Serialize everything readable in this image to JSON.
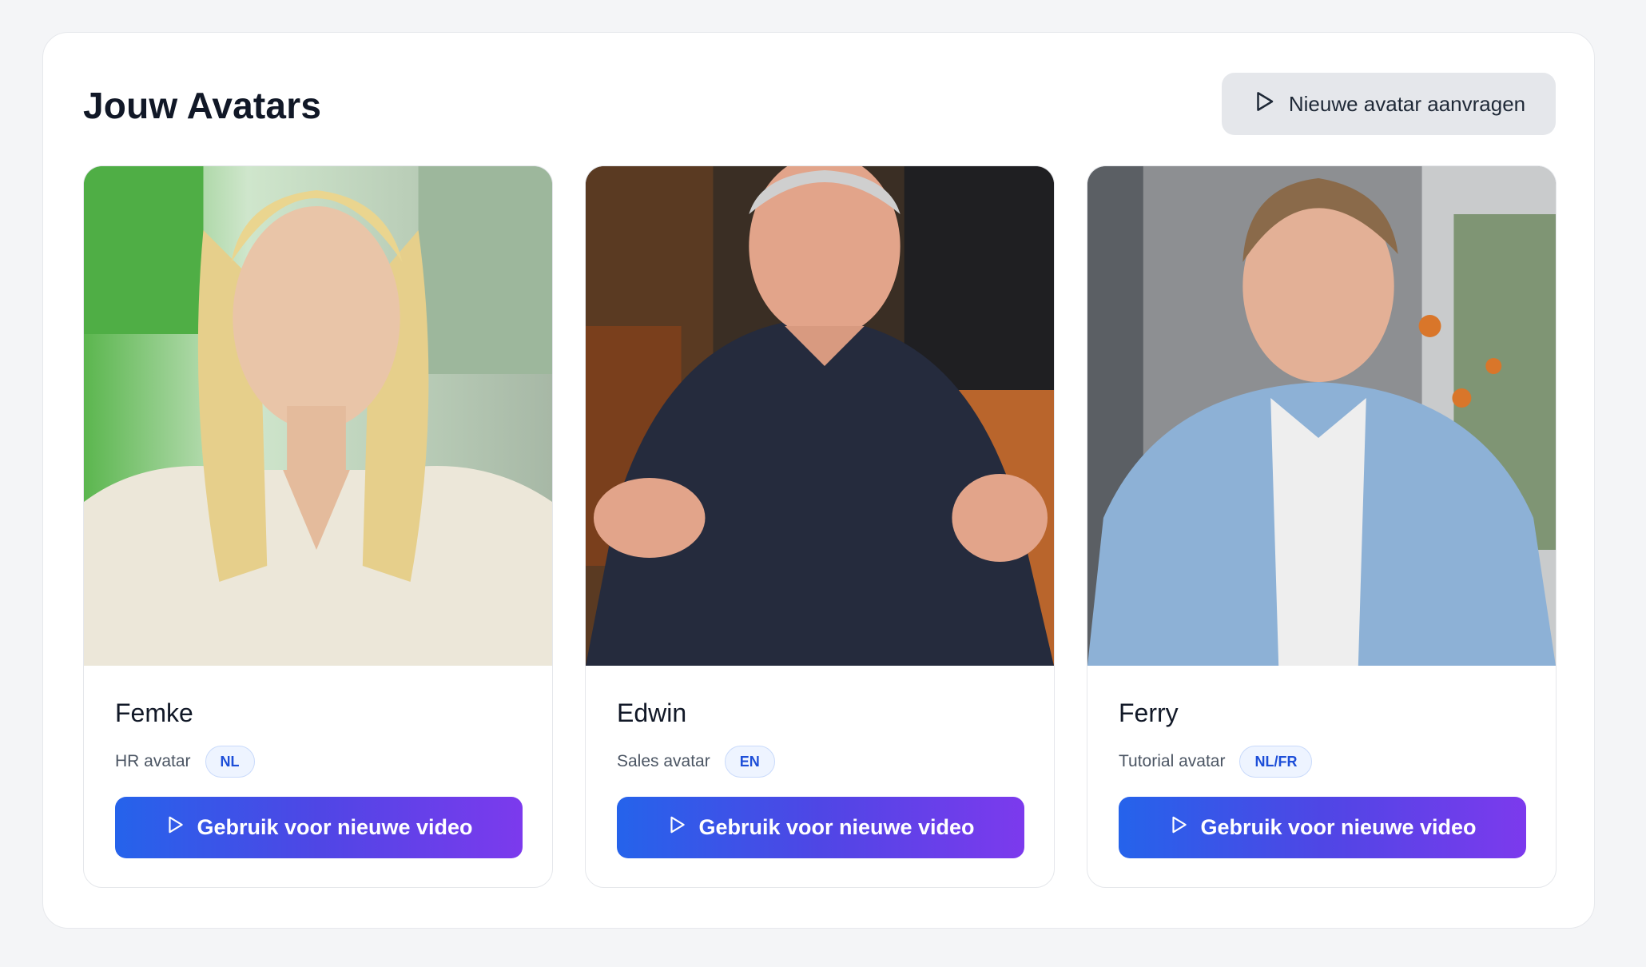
{
  "header": {
    "title": "Jouw Avatars",
    "request_button_label": "Nieuwe avatar aanvragen",
    "request_button_icon": "play-icon"
  },
  "avatars": [
    {
      "name": "Femke",
      "role": "HR avatar",
      "language": "NL",
      "button_label": "Gebruik voor nieuwe video"
    },
    {
      "name": "Edwin",
      "role": "Sales avatar",
      "language": "EN",
      "button_label": "Gebruik voor nieuwe video"
    },
    {
      "name": "Ferry",
      "role": "Tutorial avatar",
      "language": "NL/FR",
      "button_label": "Gebruik voor nieuwe video"
    }
  ],
  "colors": {
    "button_gradient_start": "#2563eb",
    "button_gradient_end": "#7c3aed",
    "badge_text": "#1d4ed8",
    "page_background": "#f4f5f7"
  }
}
